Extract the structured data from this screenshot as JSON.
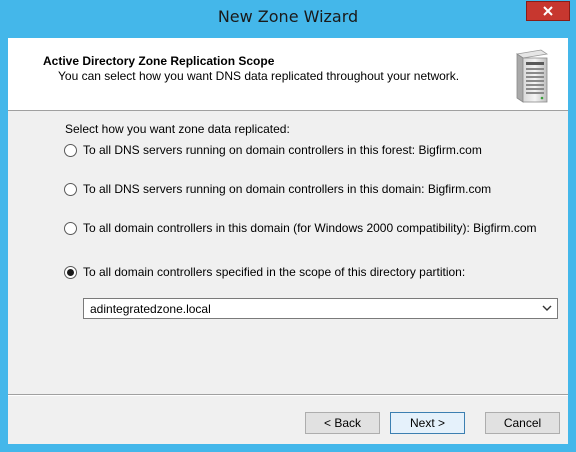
{
  "window": {
    "title": "New Zone Wizard"
  },
  "header": {
    "title": "Active Directory Zone Replication Scope",
    "subtitle": "You can select how you want DNS data replicated throughout your network."
  },
  "content": {
    "prompt": "Select how you want zone data replicated:",
    "options": [
      {
        "label": "To all DNS servers running on domain controllers in this forest: Bigfirm.com",
        "checked": false
      },
      {
        "label": "To all DNS servers running on domain controllers in this domain: Bigfirm.com",
        "checked": false
      },
      {
        "label": "To all domain controllers in this domain (for Windows 2000 compatibility): Bigfirm.com",
        "checked": false
      },
      {
        "label": "To all domain controllers specified in the scope of this directory partition:",
        "checked": true
      }
    ],
    "partition_select": {
      "value": "adintegratedzone.local"
    }
  },
  "footer": {
    "back_label": "< Back",
    "next_label": "Next >",
    "cancel_label": "Cancel"
  },
  "icons": {
    "close": "close-icon",
    "server": "server-icon",
    "dropdown": "chevron-down-icon"
  },
  "colors": {
    "frame": "#44b7ea",
    "close_button": "#c7372f"
  }
}
